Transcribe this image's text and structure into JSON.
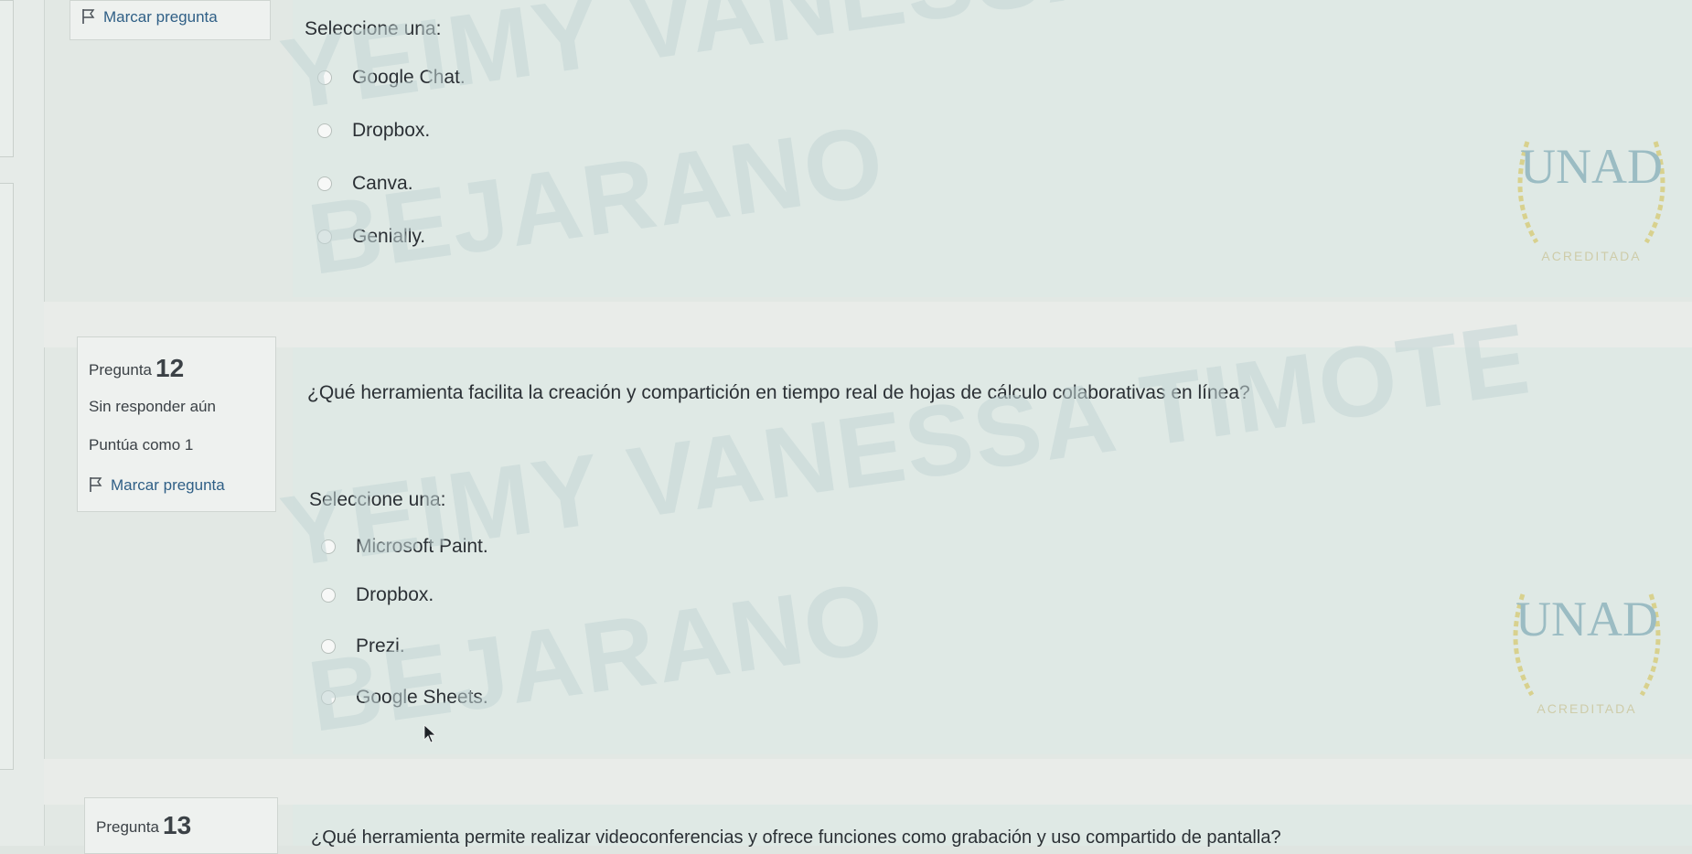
{
  "question11": {
    "flag_label": "Marcar pregunta",
    "prompt": "Seleccione una:",
    "options": [
      "Google Chat.",
      "Dropbox.",
      "Canva.",
      "Genially."
    ]
  },
  "question12": {
    "label": "Pregunta",
    "number": "12",
    "status": "Sin responder aún",
    "points": "Puntúa como 1",
    "flag_label": "Marcar pregunta",
    "text": "¿Qué herramienta facilita la creación y compartición en tiempo real de hojas de cálculo colaborativas en línea?",
    "prompt": "Seleccione una:",
    "options": [
      "Microsoft Paint.",
      "Dropbox.",
      "Prezi.",
      "Google Sheets."
    ]
  },
  "question13": {
    "label": "Pregunta",
    "number": "13",
    "text": "¿Qué herramienta permite realizar videoconferencias y ofrece funciones como grabación y uso compartido de pantalla?"
  },
  "watermark": {
    "line1": "YEIMY VANESSA TIMOTE",
    "line2": "BEJARANO"
  },
  "logo": {
    "text": "UNAD",
    "subtitle": "ACREDITADA"
  },
  "colors": {
    "accent_link": "#2f5f86",
    "logo_teal": "#7fa9b5",
    "logo_gold": "#d6c86a"
  }
}
